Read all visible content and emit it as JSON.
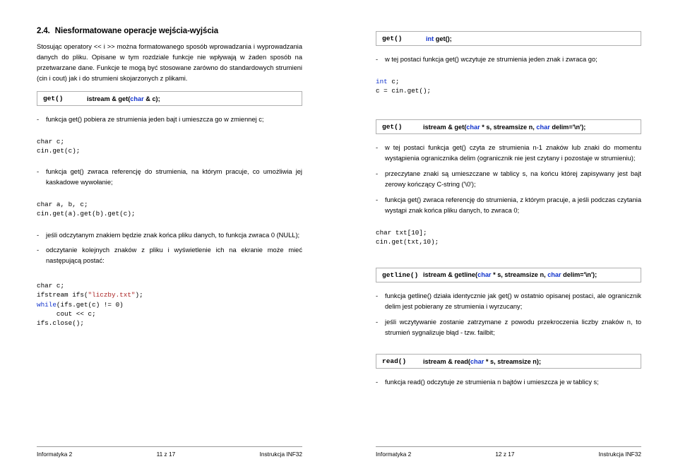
{
  "left": {
    "heading": {
      "number": "2.4.",
      "title": "Niesformatowane operacje wejścia-wyjścia"
    },
    "intro": "Stosując operatory << i >> można formatowanego sposób wprowadzania i wyprowadzania danych do pliku. Opisane w tym rozdziale funkcje nie wpływają w żaden sposób na przetwarzane dane. Funkcje te mogą być stosowane zarówno do standardowych strumieni (cin i cout) jak i do strumieni skojarzonych z plikami.",
    "sig1": {
      "fn": "get()",
      "sig_pre": "istream & get(",
      "sig_kw": "char",
      "sig_post": " & c);"
    },
    "item1": "funkcja get() pobiera ze strumienia jeden bajt i umieszcza go w zmiennej c;",
    "code1": "char c;\ncin.get(c);",
    "item2": "funkcja get() zwraca referencję do strumienia, na którym pracuje, co umożliwia jej kaskadowe wywołanie;",
    "code2": "char a, b, c;\ncin.get(a).get(b).get(c);",
    "item3": "jeśli odczytanym znakiem będzie znak końca pliku danych, to funkcja zwraca 0 (NULL);",
    "item4": "odczytanie kolejnych znaków z pliku i wyświetlenie ich na ekranie może mieć następującą postać:",
    "code3_l1": "char c;",
    "code3_l2_a": "ifstream ifs(",
    "code3_l2_str": "\"liczby.txt\"",
    "code3_l2_b": ");",
    "code3_l3": "while(ifs.get(c) != 0)",
    "code3_l4": "     cout << c;",
    "code3_l5": "ifs.close();",
    "footer": {
      "left": "Informatyka 2",
      "mid": "11 z 17",
      "right": "Instrukcja INF32"
    }
  },
  "right": {
    "sig1": {
      "fn": "get()",
      "sig_kw": "int",
      "sig_post": " get();"
    },
    "item1": "w tej postaci funkcja get() wczytuje ze strumienia jeden znak i zwraca go;",
    "code1_kw": "int",
    "code1_rest": " c;\nc = cin.get();",
    "sig2": {
      "fn": "get()",
      "sig_pre": "istream & get(",
      "sig_kw1": "char",
      "sig_mid": " * s, streamsize n, ",
      "sig_kw2": "char",
      "sig_post": " delim='\\n');"
    },
    "item2": "w tej postaci funkcja get() czyta ze strumienia n-1 znaków lub znaki do momentu wystąpienia ogranicznika delim (ogranicznik nie jest czytany i pozostaje w strumieniu);",
    "item3": "przeczytane znaki są umieszczane w tablicy s, na końcu której zapisywany jest bajt zerowy kończący C-string ('\\0');",
    "item4": "funkcja get() zwraca referencję do strumienia, z którym pracuje, a jeśli podczas czytania wystąpi znak końca pliku danych, to zwraca 0;",
    "code2": "char txt[10];\ncin.get(txt,10);",
    "sig3": {
      "fn": "getline()",
      "sig_pre": "istream & getline(",
      "sig_kw1": "char",
      "sig_mid": " * s, streamsize n, ",
      "sig_kw2": "char",
      "sig_post": " delim='\\n');"
    },
    "item5": "funkcja getline() działa identycznie jak get() w ostatnio opisanej postaci, ale ogranicznik delim jest pobierany ze strumienia i wyrzucany;",
    "item6": "jeśli wczytywanie zostanie zatrzymane z powodu przekroczenia liczby znaków n, to strumień sygnalizuje błąd - tzw. failbit;",
    "sig4": {
      "fn": "read()",
      "sig_pre": "istream & read(",
      "sig_kw": "char",
      "sig_post": " * s, streamsize n);"
    },
    "item7": "funkcja read() odczytuje ze strumienia n bajtów i umieszcza je w tablicy s;",
    "footer": {
      "left": "Informatyka 2",
      "mid": "12 z 17",
      "right": "Instrukcja INF32"
    }
  }
}
